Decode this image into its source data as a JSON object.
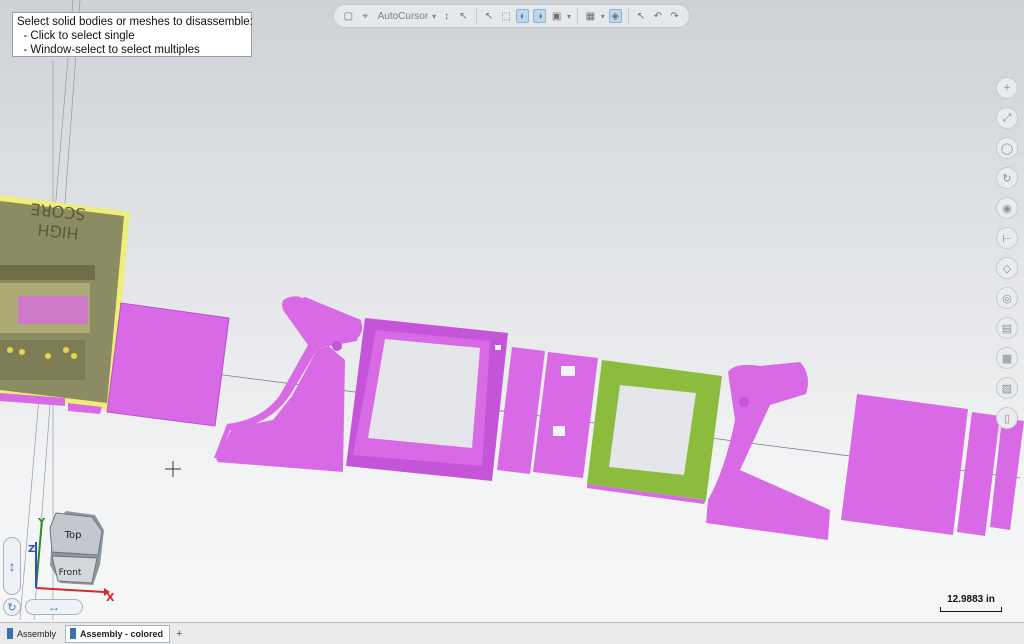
{
  "prompt": {
    "lines": [
      "Select solid bodies or meshes to disassemble:",
      "  - Click to select single",
      "  - Window-select to select multiples"
    ]
  },
  "toolbar": {
    "snap_label": "AutoCursor",
    "buttons": [
      "sketch-icon",
      "autocursor-icon",
      "xyz-icon",
      "pointer-icon",
      "select-icon",
      "view-icon",
      "render-icon",
      "shade-icon",
      "box-icon",
      "layer-icon",
      "undo-icon",
      "redo-icon"
    ]
  },
  "right_tools": [
    "zoom-icon",
    "fit-icon",
    "orbit-icon",
    "pan-icon",
    "camera-icon",
    "measure-icon",
    "tag-icon",
    "section-icon",
    "clip-icon",
    "color-icon",
    "paint-icon",
    "info-icon"
  ],
  "view_cube": {
    "top_label": "Top",
    "front_label": "Front",
    "axis_x": "X",
    "axis_y": "Y",
    "axis_z": "Z"
  },
  "scale": {
    "value": "12.9883 in"
  },
  "cabinet_text": [
    "HIGH",
    "SCORE"
  ],
  "tabs": [
    {
      "label": "Assembly",
      "active": false
    },
    {
      "label": "Assembly - colored",
      "active": true
    }
  ],
  "tab_add_label": "+",
  "colors": {
    "part_magenta": "#d86ae6",
    "part_green": "#8bbc3d",
    "cabinet_olive": "#8a8a5a",
    "highlight_yellow": "#f3f07a"
  }
}
